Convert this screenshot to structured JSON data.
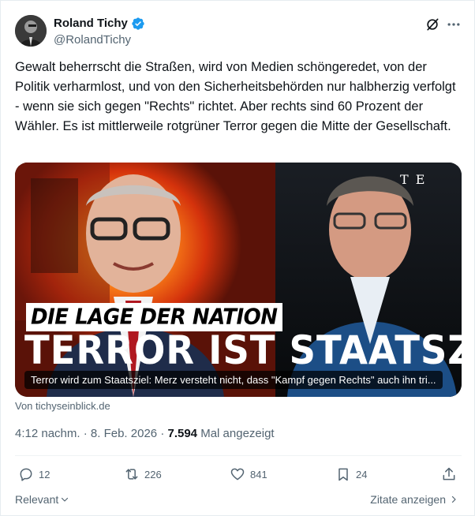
{
  "author": {
    "name": "Roland Tichy",
    "handle": "@RolandTichy",
    "verified": true
  },
  "tweet": {
    "text": "Gewalt beherrscht die Straßen, wird von Medien schöngeredet, von der Politik verharmlost, und von den Sicherheitsbehörden nur halbherzig verfolgt - wenn sie sich gegen \"Rechts\" richtet. Aber rechts sind 60 Prozent der Wähler. Es ist mittlerweile rotgrüner Terror gegen die Mitte der Gesellschaft."
  },
  "media": {
    "overlay_small": "DIE LAGE DER NATION",
    "overlay_headline": "TERROR IST STAATSZIEL",
    "logo": "T E",
    "caption": "Terror wird zum Staatsziel: Merz versteht nicht, dass \"Kampf gegen Rechts\" auch ihn tri...",
    "source": "Von tichyseinblick.de"
  },
  "meta": {
    "time": "4:12 nachm.",
    "date": "8. Feb. 2026",
    "views": "7.594",
    "views_label": "Mal angezeigt"
  },
  "actions": {
    "replies": "12",
    "reposts": "226",
    "likes": "841",
    "bookmarks": "24"
  },
  "footer": {
    "relevant": "Relevant",
    "quotes": "Zitate anzeigen"
  },
  "colors": {
    "text": "#0f1419",
    "secondary": "#536471",
    "verified": "#1d9bf0"
  }
}
